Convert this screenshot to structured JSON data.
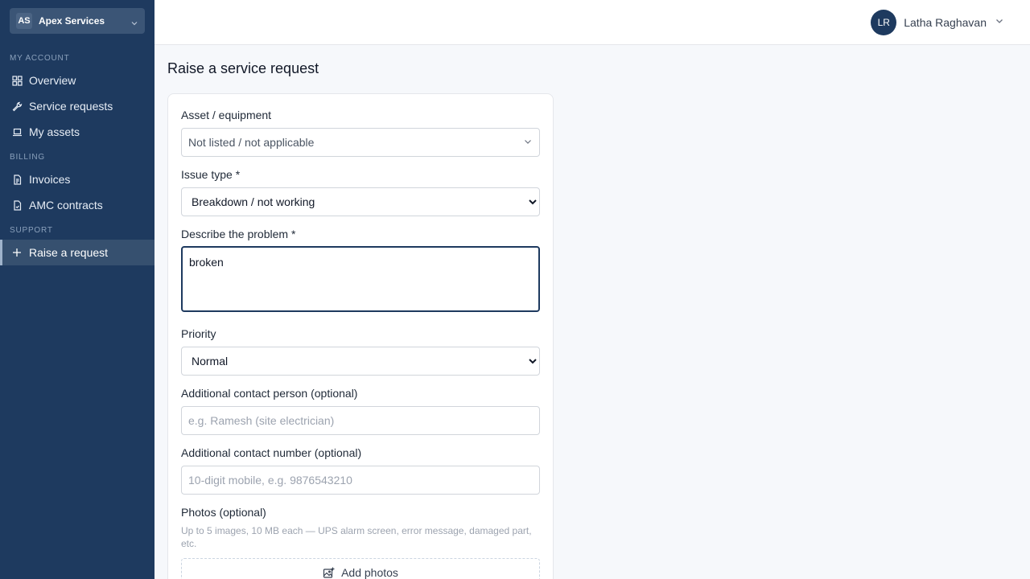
{
  "sidebar": {
    "org": {
      "initials": "AS",
      "name": "Apex Services"
    },
    "sections": [
      {
        "title": "MY ACCOUNT"
      },
      {
        "title": "BILLING"
      },
      {
        "title": "SUPPORT"
      }
    ],
    "items": [
      {
        "label": "Overview",
        "icon": "grid-icon"
      },
      {
        "label": "Service requests",
        "icon": "wrench-icon"
      },
      {
        "label": "My assets",
        "icon": "laptop-icon"
      },
      {
        "label": "Invoices",
        "icon": "document-icon"
      },
      {
        "label": "AMC contracts",
        "icon": "contract-icon"
      },
      {
        "label": "Raise a request",
        "icon": "plus-icon",
        "active": true
      }
    ]
  },
  "topbar": {
    "user": {
      "initials": "LR",
      "name": "Latha Raghavan"
    }
  },
  "page": {
    "title": "Raise a service request"
  },
  "form": {
    "asset": {
      "label": "Asset / equipment",
      "value": "Not listed / not applicable"
    },
    "issue_type": {
      "label": "Issue type *",
      "value": "Breakdown / not working"
    },
    "description": {
      "label": "Describe the problem *",
      "value": "broken"
    },
    "priority": {
      "label": "Priority",
      "value": "Normal"
    },
    "contact_person": {
      "label": "Additional contact person (optional)",
      "placeholder": "e.g. Ramesh (site electrician)"
    },
    "contact_number": {
      "label": "Additional contact number (optional)",
      "placeholder": "10-digit mobile, e.g. 9876543210"
    },
    "photos": {
      "label": "Photos (optional)",
      "hint": "Up to 5 images, 10 MB each — UPS alarm screen, error message, damaged part, etc.",
      "button": "Add photos"
    }
  },
  "colors": {
    "sidebar_bg": "#1e3a5f",
    "accent": "#1e3a5f",
    "page_bg": "#f6f8fb"
  }
}
